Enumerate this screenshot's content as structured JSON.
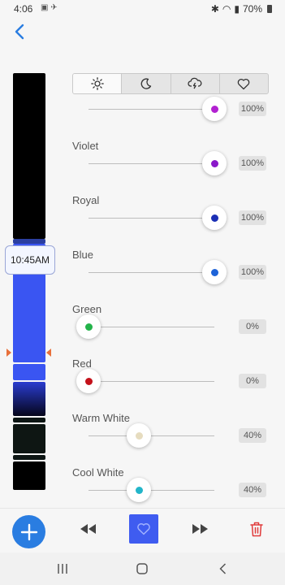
{
  "status": {
    "time": "4:06",
    "battery": "70%"
  },
  "timeline": {
    "current_time": "10:45AM"
  },
  "tabs": [
    "sun-icon",
    "moon-icon",
    "cloud-lightning-icon",
    "heart-icon"
  ],
  "channels": [
    {
      "label": "",
      "value": "100%",
      "fraction": 1.0,
      "color": "#b221d1"
    },
    {
      "label": "Violet",
      "value": "100%",
      "fraction": 1.0,
      "color": "#8a18c9"
    },
    {
      "label": "Royal",
      "value": "100%",
      "fraction": 1.0,
      "color": "#1b2fb5"
    },
    {
      "label": "Blue",
      "value": "100%",
      "fraction": 1.0,
      "color": "#1e63d8"
    },
    {
      "label": "Green",
      "value": "0%",
      "fraction": 0.0,
      "color": "#23b34a"
    },
    {
      "label": "Red",
      "value": "0%",
      "fraction": 0.0,
      "color": "#c4111a"
    },
    {
      "label": "Warm White",
      "value": "40%",
      "fraction": 0.4,
      "color": "#e6dcbf"
    },
    {
      "label": "Cool White",
      "value": "40%",
      "fraction": 0.4,
      "color": "#22b5c9"
    }
  ],
  "colors": {
    "accent": "#2a7de1",
    "favorite": "#3f5cf0",
    "delete": "#e03a3a"
  }
}
